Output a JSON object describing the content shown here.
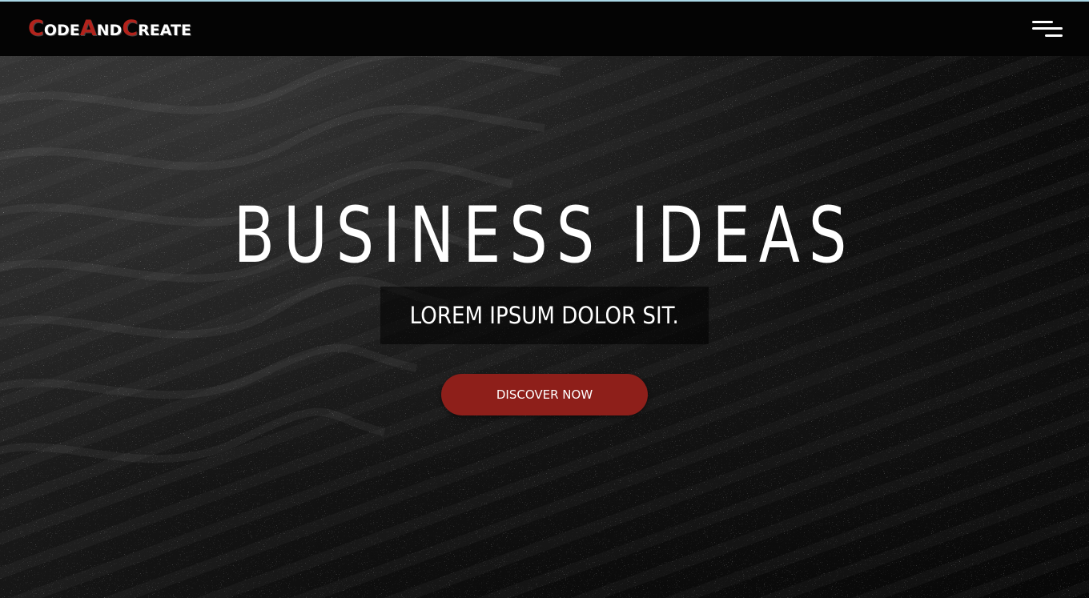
{
  "navbar": {
    "logo": {
      "parts": [
        {
          "cap": "C",
          "rest": "ode"
        },
        {
          "cap": "A",
          "rest": "nd"
        },
        {
          "cap": "C",
          "rest": "reate"
        }
      ]
    },
    "menu_icon": "hamburger-menu-icon"
  },
  "hero": {
    "title": "BUSINESS IDEAS",
    "subtitle": "LOREM IPSUM DOLOR SIT.",
    "cta_label": "DISCOVER NOW"
  },
  "colors": {
    "accent": "#8e1f1a",
    "logo_cap": "#b3231c",
    "top_border": "#a9d6e5"
  }
}
